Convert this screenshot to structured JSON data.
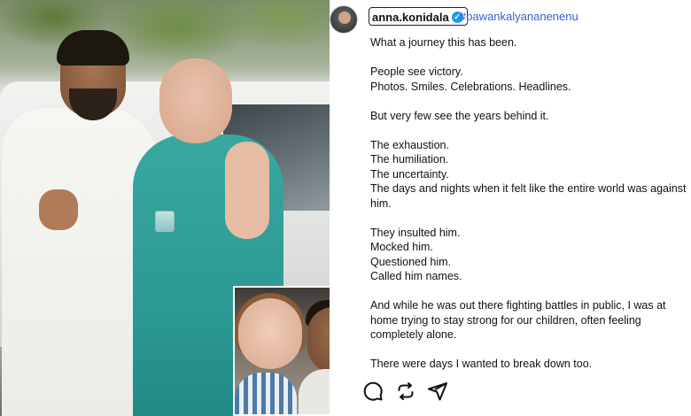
{
  "post": {
    "username": "anna.konidala",
    "hashtag": "#pawankalyananenenu",
    "verified_icon": "verified-badge-icon",
    "caption_lines": [
      "What a journey this has been.",
      "",
      "People see victory.",
      "Photos. Smiles. Celebrations. Headlines.",
      "",
      "But very few see the years behind it.",
      "",
      "The exhaustion.",
      "The humiliation.",
      "The uncertainty.",
      "The days and nights when it felt like the entire world was against",
      "him.",
      "",
      "They insulted him.",
      "Mocked him.",
      "Questioned him.",
      "Called him names.",
      "",
      "And while he was out there fighting battles in public, I was at",
      "home trying to stay strong for our children, often feeling",
      "completely alone.",
      "",
      "There were days I wanted to break down too."
    ]
  },
  "actions": {
    "comment_icon": "comment-icon",
    "repost_icon": "repost-icon",
    "share_icon": "share-icon"
  },
  "colors": {
    "hashtag": "#3b5fcf",
    "verified": "#1d9bf0"
  }
}
